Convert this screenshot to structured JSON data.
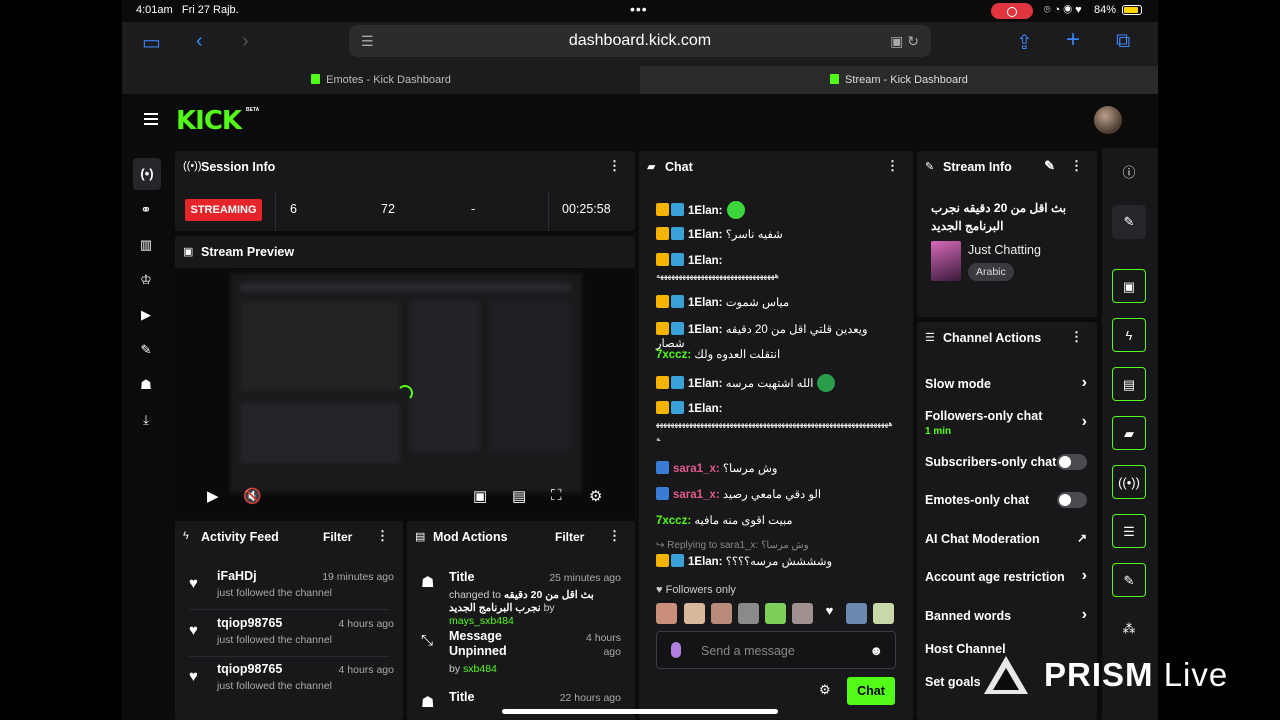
{
  "status_bar": {
    "time": "4:01am",
    "date": "Fri 27 Rajb.",
    "battery": "84%"
  },
  "browser": {
    "url": "dashboard.kick.com"
  },
  "tabs": [
    {
      "label": "Emotes - Kick Dashboard",
      "active": false
    },
    {
      "label": "Stream - Kick Dashboard",
      "active": true
    }
  ],
  "header": {
    "logo": "KICK",
    "beta": "BETA"
  },
  "session_info": {
    "title": "Session Info",
    "status_label": "STREAMING",
    "values": [
      "6",
      "72",
      "-",
      "00:25:58"
    ]
  },
  "stream_preview": {
    "title": "Stream Preview"
  },
  "activity_feed": {
    "title": "Activity Feed",
    "filter_label": "Filter",
    "items": [
      {
        "name": "iFaHDj",
        "time": "19 minutes ago",
        "action": "just followed the channel"
      },
      {
        "name": "tqiop98765",
        "time": "4 hours ago",
        "action": "just followed the channel"
      },
      {
        "name": "tqiop98765",
        "time": "4 hours ago",
        "action": "just followed the channel"
      }
    ]
  },
  "mod_actions": {
    "title": "Mod Actions",
    "filter_label": "Filter",
    "items": [
      {
        "action": "Title",
        "time": "25 minutes ago",
        "detail_prefix": "changed to",
        "detail_value": "بث اقل من 20 دقيقه نجرب البرنامج الجديد",
        "by_label": "by",
        "by": "mays_sxb484"
      },
      {
        "action": "Message Unpinned",
        "time": "4 hours ago",
        "by_label": "by",
        "by": "sxb484"
      },
      {
        "action": "Title",
        "time": "22 hours ago"
      }
    ]
  },
  "chat": {
    "title": "Chat",
    "messages": [
      {
        "user": "1Elan:",
        "text": "",
        "color": "#f4b400"
      },
      {
        "user": "1Elan:",
        "text": "شفيه ناسر؟",
        "color": "#f4b400"
      },
      {
        "user": "1Elan:",
        "text": "ههههههههههههههههههههههههههههههههه",
        "color": "#f4b400"
      },
      {
        "user": "1Elan:",
        "text": "مياس شموت",
        "color": "#f4b400"
      },
      {
        "user": "1Elan:",
        "text": "ويعدين قلتي اقل من 20 دقيقه شصار",
        "color": "#f4b400"
      },
      {
        "user": "7xccz:",
        "text": "انتقلت العدوه ولك",
        "color": "#53fc18"
      },
      {
        "user": "1Elan:",
        "text": "الله اشتهيت مرسه",
        "color": "#f4b400"
      },
      {
        "user": "1Elan:",
        "text": "ههههههههههههههههههههههههههههههههههههههههههههههههههههههههههههههههه",
        "color": "#f4b400"
      },
      {
        "user": "sara1_x:",
        "text": "وش مرسا؟",
        "color": "#e05a8a"
      },
      {
        "user": "sara1_x:",
        "text": "الو دقي مامعي رصيد",
        "color": "#e05a8a"
      },
      {
        "user": "7xccz:",
        "text": "مبيت اقوى منه مافيه",
        "color": "#53fc18"
      },
      {
        "user": "1Elan:",
        "text": "وشششش مرسه؟؟؟؟",
        "color": "#f4b400"
      }
    ],
    "reply_label": "Replying to sara1_x: وش مرسا؟",
    "followers_only": "Followers only",
    "input_placeholder": "Send a message",
    "send_label": "Chat"
  },
  "stream_info": {
    "title": "Stream Info",
    "stream_title": "بث اقل من 20 دقيقه نجرب البرنامج الجديد",
    "category": "Just Chatting",
    "language": "Arabic"
  },
  "channel_actions": {
    "title": "Channel Actions",
    "items": [
      {
        "label": "Slow mode",
        "control": "chevron"
      },
      {
        "label": "Followers-only chat",
        "sub": "1 min",
        "control": "chevron"
      },
      {
        "label": "Subscribers-only chat",
        "control": "toggle"
      },
      {
        "label": "Emotes-only chat",
        "control": "toggle"
      },
      {
        "label": "AI Chat Moderation",
        "control": "external"
      },
      {
        "label": "Account age restriction",
        "control": "chevron"
      },
      {
        "label": "Banned words",
        "control": "chevron"
      },
      {
        "label": "Host Channel",
        "control": "none"
      },
      {
        "label": "Set goals",
        "control": "none"
      }
    ]
  },
  "watermark": {
    "brand": "PRISM",
    "suffix": "Live"
  },
  "colors": {
    "accent": "#53fc18",
    "live": "#e5252a",
    "panel": "#18181b",
    "background": "#0b0b0c"
  }
}
